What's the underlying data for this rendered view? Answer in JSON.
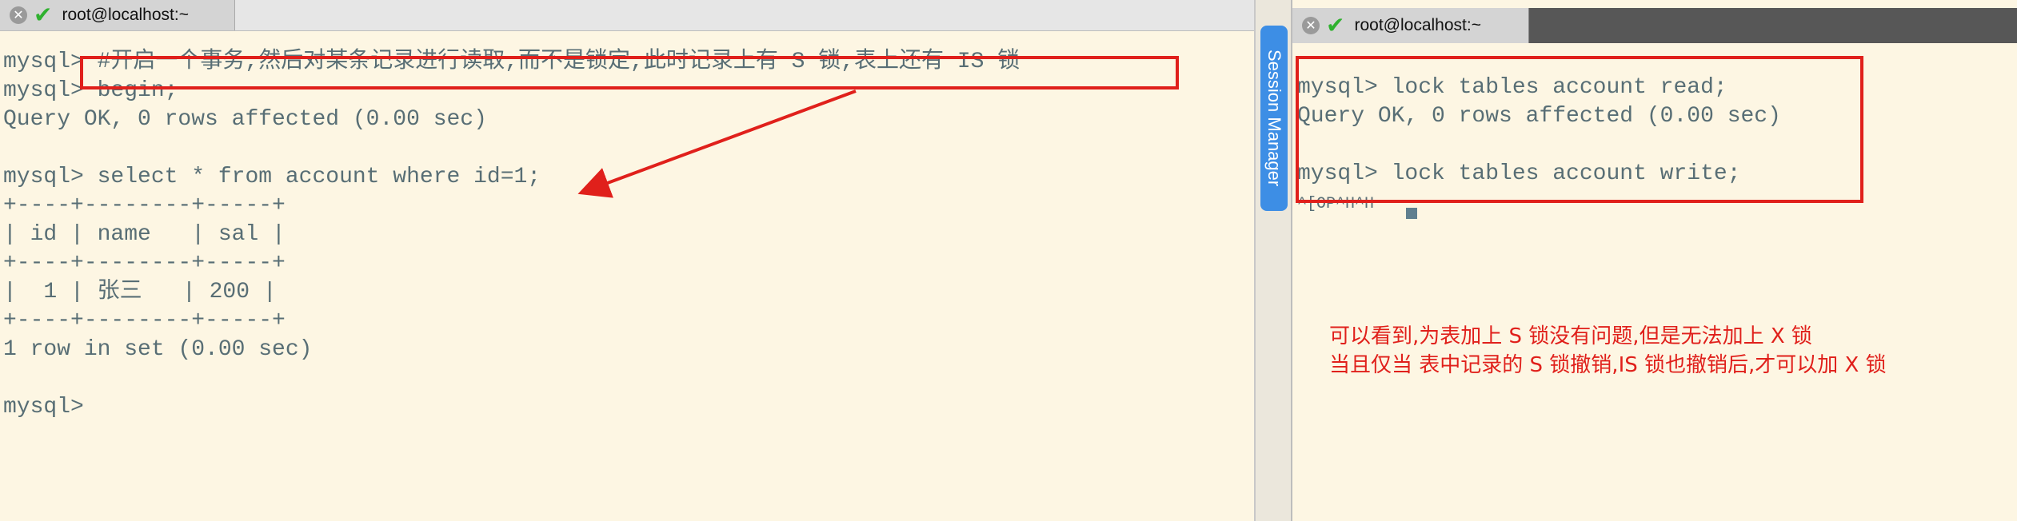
{
  "left_terminal": {
    "tab_title": "root@localhost:~",
    "lines": [
      "mysql> #开启一个事务,然后对某条记录进行读取,而不是锁定,此时记录上有 S 锁,表上还有 IS 锁",
      "mysql> begin;",
      "Query OK, 0 rows affected (0.00 sec)",
      "",
      "mysql> select * from account where id=1;",
      "+----+--------+-----+",
      "| id | name   | sal |",
      "+----+--------+-----+",
      "|  1 | 张三   | 200 |",
      "+----+--------+-----+",
      "1 row in set (0.00 sec)",
      "",
      "mysql>"
    ]
  },
  "session_manager": {
    "label": "Session Manager"
  },
  "right_terminal": {
    "tab_title": "root@localhost:~",
    "lines": [
      "mysql> lock tables account read;",
      "Query OK, 0 rows affected (0.00 sec)",
      "",
      "mysql> lock tables account write;",
      "^[OP^H^H"
    ],
    "annotation_lines": [
      "可以看到,为表加上 S 锁没有问题,但是无法加上 X 锁",
      "当且仅当 表中记录的 S 锁撤销,IS 锁也撤销后,才可以加 X 锁"
    ]
  },
  "colors": {
    "background": "#fdf6e3",
    "terminal_text": "#586e75",
    "annotation_red": "#e0201b",
    "session_manager_blue": "#3d8ee5",
    "success_check": "#2fb12f"
  },
  "icons": [
    "close-icon",
    "checkmark-icon",
    "arrow-annotation"
  ]
}
